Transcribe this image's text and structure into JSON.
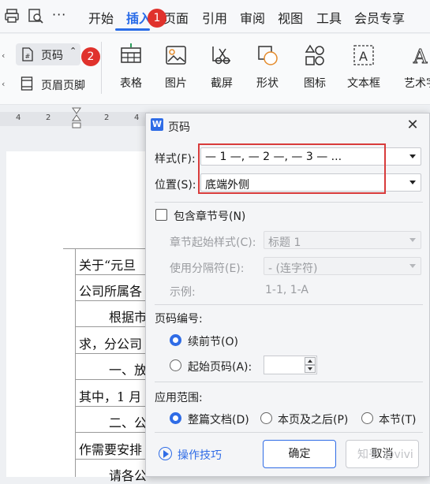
{
  "menubar": {
    "tabs": [
      "开始",
      "插入",
      "页面",
      "引用",
      "审阅",
      "视图",
      "工具",
      "会员专享"
    ],
    "more": "···"
  },
  "badges": {
    "one": "1",
    "two": "2"
  },
  "ribbon": {
    "page_number": "页码",
    "header_footer": "页眉页脚",
    "buttons": [
      "表格",
      "图片",
      "截屏",
      "形状",
      "图标",
      "文本框",
      "艺术字"
    ]
  },
  "ruler": [
    "4",
    "2",
    "2",
    "4"
  ],
  "document": {
    "lines": [
      "关于“元旦",
      "公司所属各",
      "根据市",
      "求，分公司",
      "一、放",
      "其中，1 月",
      "二、公",
      "作需要安排",
      "请各公"
    ]
  },
  "dialog": {
    "title": "页码",
    "style": {
      "label": "样式(F):",
      "value": "— 1 —, — 2 —, — 3 — ..."
    },
    "position": {
      "label": "位置(S):",
      "value": "底端外侧"
    },
    "include_chapter": {
      "label": "包含章节号(N)",
      "checked": false
    },
    "chapter_style": {
      "label": "章节起始样式(C):",
      "value": "标题 1"
    },
    "separator": {
      "label": "使用分隔符(E):",
      "value": "-   (连字符)"
    },
    "example": {
      "label": "示例:",
      "value": "1-1, 1-A"
    },
    "numbering": {
      "heading": "页码编号:",
      "continue": "续前节(O)",
      "start": "起始页码(A):",
      "start_value": "",
      "selected": "continue"
    },
    "scope": {
      "heading": "应用范围:",
      "whole": "整篇文档(D)",
      "after": "本页及之后(P)",
      "section": "本节(T)",
      "selected": "whole"
    },
    "tips": "操作技巧",
    "ok": "确定",
    "cancel": "取消"
  },
  "watermark": "知乎 @vivi",
  "colors": {
    "accent": "#2f6ce6",
    "highlight": "#d83b3b",
    "badge": "#e0322c"
  }
}
